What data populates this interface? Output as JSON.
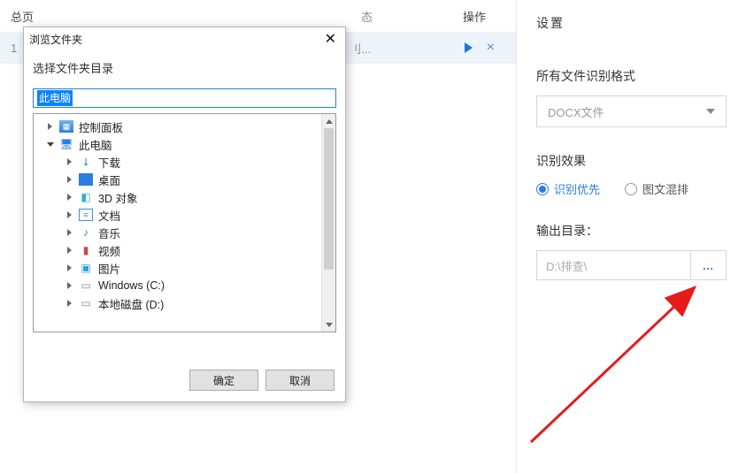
{
  "bg": {
    "left_head_total": "总页",
    "left_head_op": "操作",
    "left_head_state": "态",
    "row_idx": "1",
    "row_ellipsis": "刂..."
  },
  "settings": {
    "title": "设置",
    "fmt_label": "所有文件识别格式",
    "fmt_value": "DOCX文件",
    "effect_label": "识别效果",
    "radio1": "识别优先",
    "radio2": "图文混排",
    "out_label": "输出目录：",
    "out_value": "D:\\排查\\",
    "out_btn": "…"
  },
  "dialog": {
    "title": "浏览文件夹",
    "subtitle": "选择文件夹目录",
    "input_value": "此电脑",
    "ok": "确定",
    "cancel": "取消",
    "tree": {
      "control_panel": "控制面板",
      "this_pc": "此电脑",
      "downloads": "下载",
      "desktop": "桌面",
      "objects_3d": "3D 对象",
      "documents": "文档",
      "music": "音乐",
      "videos": "视频",
      "pictures": "图片",
      "drive_c": "Windows (C:)",
      "drive_d": "本地磁盘 (D:)"
    }
  }
}
